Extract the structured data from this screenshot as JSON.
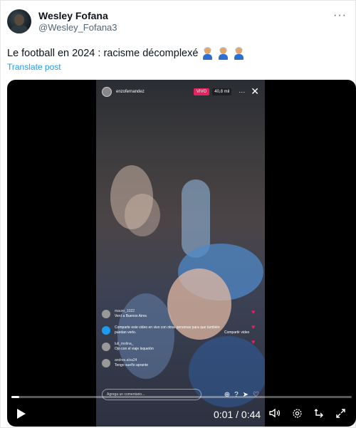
{
  "post": {
    "author": {
      "display_name": "Wesley Fofana",
      "handle": "@Wesley_Fofana3"
    },
    "text": "Le football en 2024 : racisme décomplexé",
    "emoji_icons": [
      "person-white-hair-icon",
      "person-white-hair-icon",
      "person-white-hair-icon"
    ],
    "translate_label": "Translate post",
    "more_icon": "more-horizontal-icon",
    "colors": {
      "link": "#1d9bf0",
      "text": "#0f1419",
      "secondary": "#536471"
    }
  },
  "video": {
    "live_overlay": {
      "username": "enzofernandez",
      "live_badge": "VIVO",
      "viewers": "40,8 mil",
      "comments": [
        {
          "user": "mauro_1022",
          "text": "Vení a Buenos Aires"
        },
        {
          "user": "",
          "text": "Comparte este video en vivo con otras personas para que también puedan verlo."
        },
        {
          "user": "luli_molina_",
          "text": "Ojo con el viaje loquetón"
        },
        {
          "user": "andres.alva24",
          "text": "Tengo sueño aprante"
        }
      ],
      "share_label": "Compartir video",
      "comment_placeholder": "Agrega un comentario..."
    },
    "progress": 0.023,
    "time_display": "0:01 / 0:44",
    "controls": {
      "play_icon": "play-icon",
      "volume_icon": "volume-icon",
      "settings_icon": "settings-gear-icon",
      "rotate_icon": "rotate-icon",
      "fullscreen_icon": "fullscreen-icon"
    }
  }
}
